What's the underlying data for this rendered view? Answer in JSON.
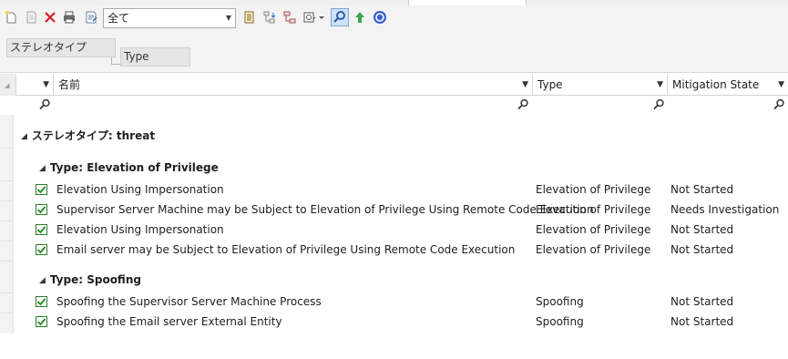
{
  "toolbar": {
    "filter_value": "全て",
    "icons": [
      "new-element-icon",
      "copy-icon",
      "delete-icon",
      "print-icon",
      "properties-icon",
      "column-settings-icon",
      "sort-tree-icon",
      "hierarchy-icon",
      "options-icon",
      "search-icon",
      "up-arrow-icon",
      "help-icon"
    ]
  },
  "groupbar": {
    "chip1": "ステレオタイプ",
    "chip2": "Type"
  },
  "columns": {
    "name": "名前",
    "type": "Type",
    "mitigation": "Mitigation State"
  },
  "groups": {
    "stereotype_label": "ステレオタイプ: threat",
    "elevation_label": "Type: Elevation of Privilege",
    "spoofing_label": "Type: Spoofing"
  },
  "rows_elevation": [
    {
      "name": "Elevation Using Impersonation",
      "type": "Elevation of Privilege",
      "mitigation": "Not Started"
    },
    {
      "name": "Supervisor Server Machine may be Subject to Elevation of Privilege Using Remote Code Execution",
      "type": "Elevation of Privilege",
      "mitigation": "Needs Investigation"
    },
    {
      "name": "Elevation Using Impersonation",
      "type": "Elevation of Privilege",
      "mitigation": "Not Started"
    },
    {
      "name": "Email server may be Subject to Elevation of Privilege Using Remote Code Execution",
      "type": "Elevation of Privilege",
      "mitigation": "Not Started"
    }
  ],
  "rows_spoofing": [
    {
      "name": "Spoofing the Supervisor Server Machine Process",
      "type": "Spoofing",
      "mitigation": "Not Started"
    },
    {
      "name": "Spoofing the Email server External Entity",
      "type": "Spoofing",
      "mitigation": "Not Started"
    }
  ]
}
